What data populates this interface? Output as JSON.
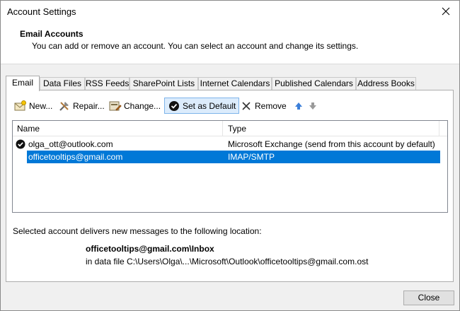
{
  "window": {
    "title": "Account Settings"
  },
  "header": {
    "title": "Email Accounts",
    "description": "You can add or remove an account. You can select an account and change its settings."
  },
  "tabs": [
    {
      "label": "Email",
      "active": true
    },
    {
      "label": "Data Files"
    },
    {
      "label": "RSS Feeds"
    },
    {
      "label": "SharePoint Lists"
    },
    {
      "label": "Internet Calendars"
    },
    {
      "label": "Published Calendars"
    },
    {
      "label": "Address Books"
    }
  ],
  "toolbar": {
    "new_label": "New...",
    "repair_label": "Repair...",
    "change_label": "Change...",
    "set_default_label": "Set as Default",
    "remove_label": "Remove"
  },
  "accounts": {
    "columns": {
      "name": "Name",
      "type": "Type"
    },
    "rows": [
      {
        "name": "olga_ott@outlook.com",
        "type": "Microsoft Exchange (send from this account by default)",
        "is_default": true
      },
      {
        "name": "officetooltips@gmail.com",
        "type": "IMAP/SMTP",
        "selected": true
      }
    ]
  },
  "delivery": {
    "label": "Selected account delivers new messages to the following location:",
    "account": "officetooltips@gmail.com\\Inbox",
    "path": "in data file C:\\Users\\Olga\\...\\Microsoft\\Outlook\\officetooltips@gmail.com.ost"
  },
  "footer": {
    "close_label": "Close"
  },
  "colors": {
    "selection": "#0078d7",
    "accent_blue": "#3b7fd9"
  }
}
